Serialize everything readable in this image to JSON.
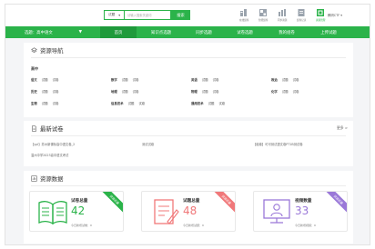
{
  "header": {
    "search": {
      "scope": "试题",
      "placeholder": "请输入搜索关键词",
      "button": "搜索"
    },
    "quick_links": [
      {
        "label": "在线组卷",
        "icon": "paper-compose-icon"
      },
      {
        "label": "智能组卷",
        "icon": "smart-compose-icon"
      },
      {
        "label": "同步资源",
        "icon": "sync-resource-icon"
      },
      {
        "label": "组卷记录",
        "icon": "record-icon"
      },
      {
        "label": "资源管理",
        "icon": "resource-manage-icon"
      }
    ],
    "user": "教研CTF ▾"
  },
  "nav": {
    "subject": "选题：高中语文",
    "items": [
      "首页",
      "知识点选题",
      "同步选题",
      "试卷选题",
      "我的组卷",
      "上传试题"
    ],
    "active_index": 0
  },
  "resource_nav": {
    "title": "资源导航",
    "grade": "高中",
    "rows": [
      [
        {
          "subject": "语文",
          "links": [
            "试题",
            "试卷"
          ]
        },
        {
          "subject": "数学",
          "links": [
            "试题",
            "试卷"
          ]
        },
        {
          "subject": "英语",
          "links": [
            "试题",
            "试卷"
          ]
        },
        {
          "subject": "政治",
          "links": [
            "试题",
            "试卷"
          ]
        }
      ],
      [
        {
          "subject": "历史",
          "links": [
            "试题",
            "试卷"
          ]
        },
        {
          "subject": "地理",
          "links": [
            "试题",
            "试卷"
          ]
        },
        {
          "subject": "物理",
          "links": [
            "试题",
            "试卷"
          ]
        },
        {
          "subject": "化学",
          "links": [
            "试题",
            "试卷"
          ]
        }
      ],
      [
        {
          "subject": "生物",
          "links": [
            "试题",
            "试卷"
          ]
        },
        {
          "subject": "信息技术",
          "links": [
            "试题",
            "试卷"
          ]
        },
        {
          "subject": "通用技术",
          "links": [
            "试题",
            "试卷"
          ]
        }
      ]
    ]
  },
  "latest_papers": {
    "title": "最新试卷",
    "more": "更多 >",
    "items": [
      "【ypl】苏州新课标高中语文卷_2",
      "测试试卷",
      "【组卷】可可测试语文卷PT1B测试卷",
      "温州中学2023高中语文考试"
    ]
  },
  "resource_data": {
    "title": "资源数据",
    "stats": [
      {
        "title": "试卷总量",
        "value": "42",
        "today": "今日新增试卷：0",
        "ribbon": "资源总量",
        "color": "#2bb34a",
        "icon": "open-book-icon"
      },
      {
        "title": "试题总量",
        "value": "48",
        "today": "今日新增试题：0",
        "ribbon": "资源总量",
        "color": "#f0787a",
        "icon": "exam-sheet-icon"
      },
      {
        "title": "视频数量",
        "value": "33",
        "today": "今日新增视频：0",
        "ribbon": "资源总量",
        "color": "#9a78d8",
        "icon": "video-lesson-icon"
      }
    ]
  }
}
